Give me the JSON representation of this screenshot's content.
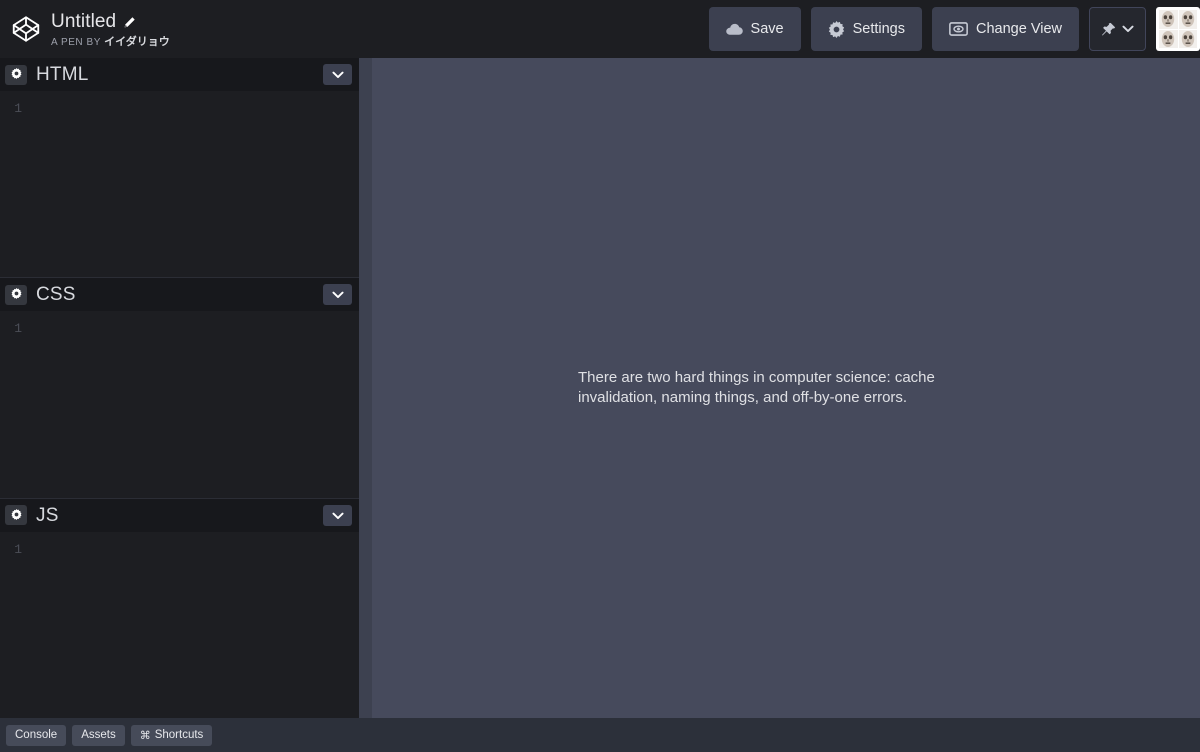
{
  "app": {
    "name": "CodePen Editor",
    "theme_colors": {
      "chrome_bg": "#1d1e22",
      "panel_header_bg": "#17181c",
      "button_bg": "#3c4050",
      "preview_bg": "#464a5c",
      "splitter": "#3d4150",
      "bottombar_bg": "#2c303a",
      "text_primary": "#e6e6e9",
      "text_muted": "#9da0ab",
      "line_number": "#4b4e57"
    }
  },
  "header": {
    "logo_icon": "codepen-logo-icon",
    "pen_title": "Untitled",
    "edit_icon": "pencil-icon",
    "byline_prefix": "A PEN BY",
    "author": "イイダリョウ",
    "actions": [
      {
        "id": "save",
        "label": "Save",
        "icon": "cloud-icon"
      },
      {
        "id": "settings",
        "label": "Settings",
        "icon": "gear-icon"
      },
      {
        "id": "change-view",
        "label": "Change View",
        "icon": "screen-icon"
      }
    ],
    "pin": {
      "icon": "pushpin-icon",
      "chevron": "chevron-down-icon",
      "label": ""
    },
    "avatar": {
      "alt": "user-avatar",
      "tiles": 4
    }
  },
  "editors": [
    {
      "id": "html",
      "label": "HTML",
      "settings_icon": "gear-icon",
      "collapse_icon": "chevron-down-icon",
      "line_numbers": [
        "1"
      ],
      "code": [
        ""
      ]
    },
    {
      "id": "css",
      "label": "CSS",
      "settings_icon": "gear-icon",
      "collapse_icon": "chevron-down-icon",
      "line_numbers": [
        "1"
      ],
      "code": [
        ""
      ]
    },
    {
      "id": "js",
      "label": "JS",
      "settings_icon": "gear-icon",
      "collapse_icon": "chevron-down-icon",
      "line_numbers": [
        "1"
      ],
      "code": [
        ""
      ]
    }
  ],
  "preview": {
    "body_text": "There are two hard things in computer science: cache invalidation, naming things, and off-by-one errors."
  },
  "bottombar": {
    "buttons": [
      {
        "id": "console",
        "label": "Console",
        "icon": ""
      },
      {
        "id": "assets",
        "label": "Assets",
        "icon": ""
      },
      {
        "id": "shortcuts",
        "label": "Shortcuts",
        "icon": "command-icon",
        "glyph": "⌘"
      }
    ]
  }
}
